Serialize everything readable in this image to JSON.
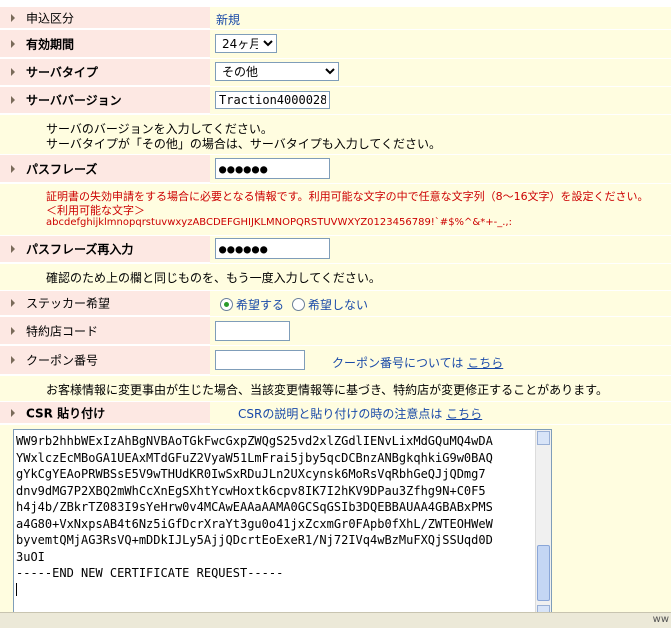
{
  "fields": {
    "application_type": {
      "label": "申込区分",
      "value": "新規"
    },
    "validity_period": {
      "label": "有効期間",
      "value": "24ヶ月"
    },
    "server_type": {
      "label": "サーバタイプ",
      "value": "その他"
    },
    "server_version": {
      "label": "サーババージョン",
      "value": "Traction4000028",
      "note_line1": "サーバのバージョンを入力してください。",
      "note_line2": "サーバタイプが「その他」の場合は、サーバタイプも入力してください。"
    },
    "passphrase": {
      "label": "パスフレーズ",
      "value": "●●●●●●",
      "note_line1": "証明書の失効申請をする場合に必要となる情報です。利用可能な文字の中で任意な文字列（8〜16文字）を設定ください。",
      "note_line2": "＜利用可能な文字＞",
      "note_line3": "abcdefghijklmnopqrstuvwxyzABCDEFGHIJKLMNOPQRSTUVWXYZ0123456789!`#$%^&*+-_.,:"
    },
    "passphrase_confirm": {
      "label": "パスフレーズ再入力",
      "value": "●●●●●●",
      "note": "確認のため上の欄と同じものを、もう一度入力してください。"
    },
    "sticker": {
      "label": "ステッカー希望",
      "option_yes": "希望する",
      "option_no": "希望しない"
    },
    "agency_code": {
      "label": "特約店コード",
      "value": ""
    },
    "coupon": {
      "label": "クーポン番号",
      "value": "",
      "info_text": "クーポン番号については",
      "info_link": "こちら",
      "notice": "お客様情報に変更事由が生じた場合、当該変更情報等に基づき、特約店が変更修正することがあります。"
    },
    "csr": {
      "label": "CSR 貼り付け",
      "info_text": "CSRの説明と貼り付けの時の注意点は",
      "info_link": "こちら",
      "lines": [
        "WW9rb2hhbWExIzAhBgNVBAoTGkFwcGxpZWQgS25vd2xlZGdlIENvLixMdGQuMQ4wDA",
        "YWxlczEcMBoGA1UEAxMTdGFuZ2VyaW51LmFrai5jby5qcDCBnzANBgkqhkiG9w0BAQ",
        "gYkCgYEAoPRWBSsE5V9wTHUdKR0IwSxRDuJLn2UXcynsk6MoRsVqRbhGeQJjQDmg7",
        "dnv9dMG7P2XBQ2mWhCcXnEgSXhtYcwHoxtk6cpv8IK7I2hKV9DPau3Zfhg9N+C0F5",
        "h4j4b/ZBkrTZ083I9sYeHrw0v4MCAwEAAaAAMA0GCSqGSIb3DQEBBAUAA4GBABxPMS",
        "a4G80+VxNxpsAB4t6Nz5iGfDcrXraYt3gu0o41jxZcxmGr0FApb0fXhL/ZWTEOHWeW",
        "byvemtQMjAG3RsVQ+mDDkIJLy5AjjQDcrtEoExeR1/Nj72IVq4wBzMuFXQjSSUqd0D",
        "3uOI",
        "-----END NEW CERTIFICATE REQUEST-----",
        ""
      ]
    }
  },
  "status_bar": {
    "text": "ww"
  },
  "colors": {
    "label_bg": "#fde8e3",
    "value_bg": "#fffde0",
    "link": "#1a4aa8",
    "notice_red": "#cc0000"
  }
}
